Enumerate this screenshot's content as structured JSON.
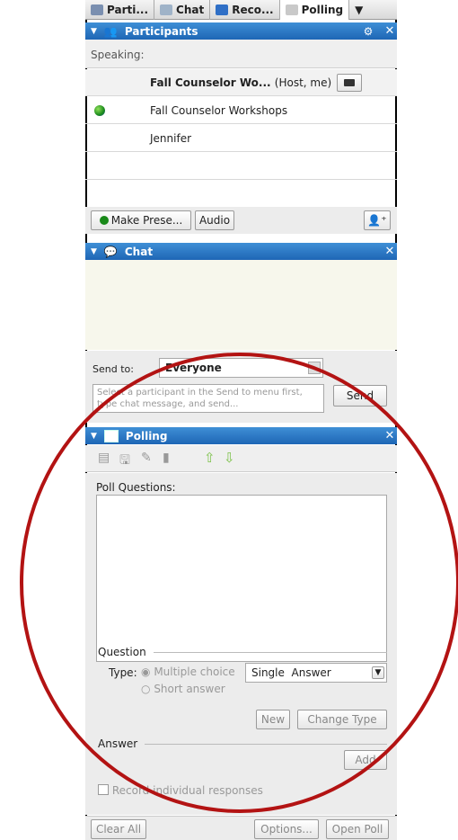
{
  "tabs": [
    {
      "label": "Parti...",
      "icon": "participants-icon",
      "active": false
    },
    {
      "label": "Chat",
      "icon": "chat-icon",
      "active": false
    },
    {
      "label": "Reco...",
      "icon": "record-icon",
      "active": false
    },
    {
      "label": "Polling",
      "icon": "polling-icon",
      "active": true
    }
  ],
  "participants": {
    "header": "Participants",
    "speaking_label": "Speaking:",
    "rows": [
      {
        "name": "Fall Counselor Wo...",
        "suffix": "(Host, me)"
      },
      {
        "name": "Fall Counselor Workshops"
      },
      {
        "name": "Jennifer"
      }
    ],
    "make_presenter": "Make Prese...",
    "audio": "Audio"
  },
  "chat": {
    "header": "Chat",
    "send_to_label": "Send to:",
    "send_to_value": "Everyone",
    "message_placeholder": "Select a participant in the Send to menu first, type chat message, and send...",
    "send_button": "Send"
  },
  "polling": {
    "header": "Polling",
    "questions_label": "Poll Questions:",
    "question_section": "Question",
    "type_label": "Type:",
    "multiple_choice": "Multiple choice",
    "short_answer": "Short answer",
    "answer_type": "Single  Answer",
    "new_button": "New",
    "change_type_button": "Change Type",
    "answer_section": "Answer",
    "add_button": "Add",
    "record_responses": "Record individual responses",
    "clear_all": "Clear All",
    "options": "Options...",
    "open_poll": "Open Poll"
  },
  "colors": {
    "header_blue": "#1e66b5",
    "annotation_red": "#b31313"
  }
}
